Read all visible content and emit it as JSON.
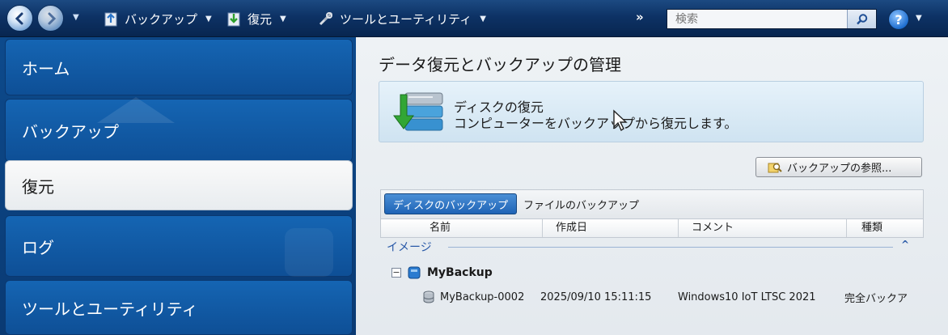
{
  "toolbar": {
    "backup_label": "バックアップ",
    "restore_label": "復元",
    "tools_label": "ツールとユーティリティ",
    "more_label": "»",
    "help_label": "?"
  },
  "search": {
    "placeholder": "検索"
  },
  "sidebar": {
    "items": [
      {
        "label": "ホーム"
      },
      {
        "label": "バックアップ"
      },
      {
        "label": "復元"
      },
      {
        "label": "ログ"
      },
      {
        "label": "ツールとユーティリティ"
      }
    ],
    "active_index": 2
  },
  "main": {
    "title": "データ復元とバックアップの管理",
    "card": {
      "title": "ディスクの復元",
      "description": "コンピューターをバックアップから復元します。"
    },
    "browse_button": "バックアップの参照...",
    "tabs": [
      {
        "label": "ディスクのバックアップ",
        "active": true
      },
      {
        "label": "ファイルのバックアップ",
        "active": false
      }
    ],
    "columns": [
      "名前",
      "作成日",
      "コメント",
      "種類"
    ],
    "group": {
      "label": "イメージ",
      "toggle": "^"
    },
    "backup": {
      "expander": "−",
      "name": "MyBackup",
      "row": {
        "name": "MyBackup-0002",
        "date": "2025/09/10 15:11:15",
        "comment": "Windows10 IoT LTSC 2021",
        "type": "完全バックア"
      }
    }
  },
  "colors": {
    "toolbar_bg": "#0d3265",
    "sidebar_bg": "#0d4a8c",
    "accent_blue": "#1f64b6",
    "group_label": "#2a5aa8"
  }
}
